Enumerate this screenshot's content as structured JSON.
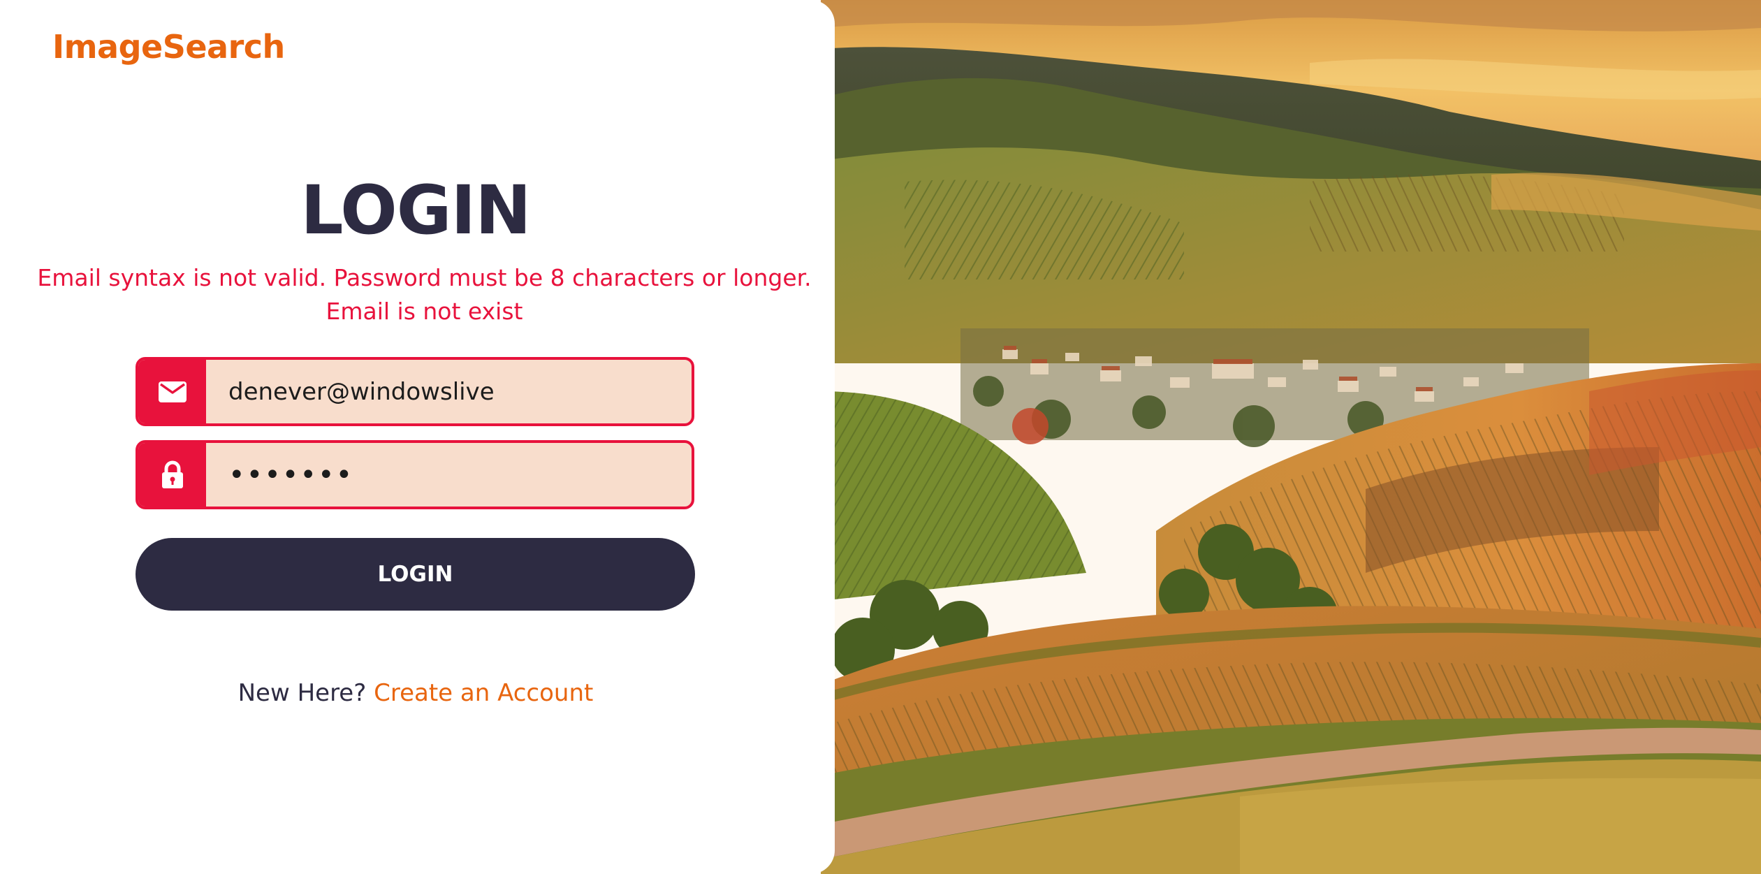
{
  "brand": {
    "name": "ImageSearch",
    "color": "#e8650f"
  },
  "login_form": {
    "title": "LOGIN",
    "errors": [
      "Email syntax is not valid. Password must be 8 characters or longer.",
      "Email is not exist"
    ],
    "email": {
      "icon": "mail-icon",
      "value": "denever@windowslive"
    },
    "password": {
      "icon": "lock-icon",
      "value": "•••••••"
    },
    "submit_label": "LOGIN"
  },
  "signup_prompt": {
    "text": "New Here?",
    "link_label": "Create an Account"
  },
  "colors": {
    "error": "#e8123c",
    "input_bg": "#f8ddcc",
    "dark": "#2d2b42",
    "accent": "#e8650f"
  },
  "background_image": {
    "subject": "vineyard hills landscape at sunset"
  }
}
